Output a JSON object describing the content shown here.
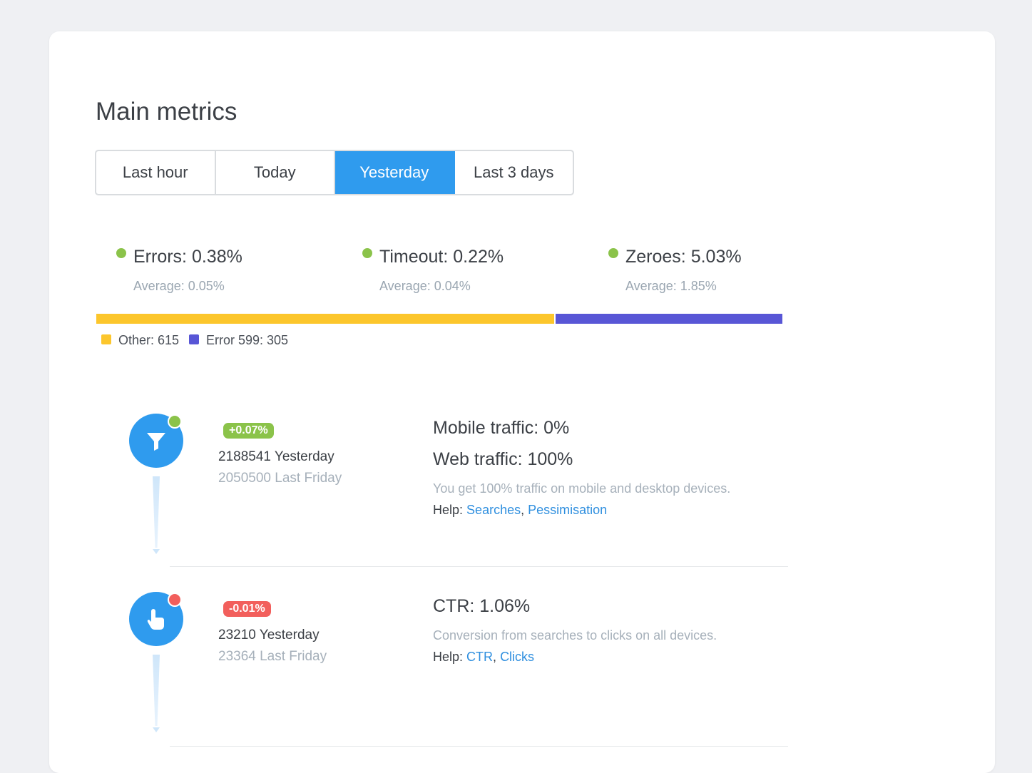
{
  "page": {
    "title": "Main metrics"
  },
  "tabs": [
    {
      "label": "Last hour",
      "active": false
    },
    {
      "label": "Today",
      "active": false
    },
    {
      "label": "Yesterday",
      "active": true
    },
    {
      "label": "Last 3 days",
      "active": false
    }
  ],
  "stats": [
    {
      "label": "Errors: 0.38%",
      "average": "Average: 0.05%",
      "status_color": "#8bc34a"
    },
    {
      "label": "Timeout: 0.22%",
      "average": "Average: 0.04%",
      "status_color": "#8bc34a"
    },
    {
      "label": "Zeroes: 5.03%",
      "average": "Average: 1.85%",
      "status_color": "#8bc34a"
    }
  ],
  "error_breakdown": {
    "segments": [
      {
        "name": "Other",
        "value": 615,
        "color": "#fcc62c",
        "legend": "Other: 615"
      },
      {
        "name": "Error 599",
        "value": 305,
        "color": "#5856d6",
        "legend": "Error 599: 305"
      }
    ]
  },
  "metrics": [
    {
      "icon": "filter-icon",
      "status_color": "#8bc34a",
      "badge": "+0.07%",
      "badge_color": "#8bc34a",
      "current": "2188541 Yesterday",
      "previous": "2050500 Last Friday",
      "headings": [
        "Mobile traffic: 0%",
        "Web traffic: 100%"
      ],
      "description": "You get 100% traffic on mobile and desktop devices.",
      "help_label": "Help:",
      "help_links": [
        "Searches",
        "Pessimisation"
      ]
    },
    {
      "icon": "tap-hand-icon",
      "status_color": "#f25f5c",
      "badge": "-0.01%",
      "badge_color": "#f25f5c",
      "current": "23210 Yesterday",
      "previous": "23364 Last Friday",
      "headings": [
        "CTR: 1.06%"
      ],
      "description": "Conversion from searches to clicks on all devices.",
      "help_label": "Help:",
      "help_links": [
        "CTR",
        "Clicks"
      ]
    }
  ]
}
